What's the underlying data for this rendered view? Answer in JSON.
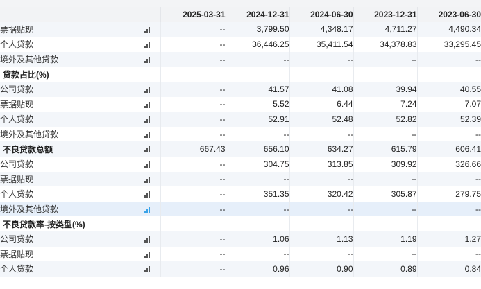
{
  "header": {
    "dates": [
      "2025-03-31",
      "2024-12-31",
      "2024-06-30",
      "2023-12-31",
      "2023-06-30"
    ]
  },
  "rows": [
    {
      "name": "票据贴现",
      "type": "item",
      "values": [
        "--",
        "3,799.50",
        "4,348.17",
        "4,711.27",
        "4,490.34"
      ]
    },
    {
      "name": "个人贷款",
      "type": "item",
      "values": [
        "--",
        "36,446.25",
        "35,411.54",
        "34,378.83",
        "33,295.45"
      ]
    },
    {
      "name": "境外及其他贷款",
      "type": "item",
      "values": [
        "--",
        "--",
        "--",
        "--",
        "--"
      ]
    },
    {
      "name": "贷款占比(%)",
      "type": "section"
    },
    {
      "name": "公司贷款",
      "type": "item",
      "values": [
        "--",
        "41.57",
        "41.08",
        "39.94",
        "40.55"
      ]
    },
    {
      "name": "票据贴现",
      "type": "item",
      "values": [
        "--",
        "5.52",
        "6.44",
        "7.24",
        "7.07"
      ]
    },
    {
      "name": "个人贷款",
      "type": "item",
      "values": [
        "--",
        "52.91",
        "52.48",
        "52.82",
        "52.39"
      ]
    },
    {
      "name": "境外及其他贷款",
      "type": "item",
      "values": [
        "--",
        "--",
        "--",
        "--",
        "--"
      ]
    },
    {
      "name": "不良贷款总额",
      "type": "section-values",
      "values": [
        "667.43",
        "656.10",
        "634.27",
        "615.79",
        "606.41"
      ]
    },
    {
      "name": "公司贷款",
      "type": "item",
      "values": [
        "--",
        "304.75",
        "313.85",
        "309.92",
        "326.66"
      ]
    },
    {
      "name": "票据贴现",
      "type": "item",
      "values": [
        "--",
        "--",
        "--",
        "--",
        "--"
      ]
    },
    {
      "name": "个人贷款",
      "type": "item",
      "values": [
        "--",
        "351.35",
        "320.42",
        "305.87",
        "279.75"
      ]
    },
    {
      "name": "境外及其他贷款",
      "type": "item",
      "highlighted": true,
      "values": [
        "--",
        "--",
        "--",
        "--",
        "--"
      ]
    },
    {
      "name": "不良贷款率-按类型(%)",
      "type": "section"
    },
    {
      "name": "公司贷款",
      "type": "item",
      "values": [
        "--",
        "1.06",
        "1.13",
        "1.19",
        "1.27"
      ]
    },
    {
      "name": "票据贴现",
      "type": "item",
      "values": [
        "--",
        "--",
        "--",
        "--",
        "--"
      ]
    },
    {
      "name": "个人贷款",
      "type": "item",
      "values": [
        "--",
        "0.96",
        "0.90",
        "0.89",
        "0.84"
      ]
    }
  ],
  "colors": {
    "header_bg": "#f2f3f5",
    "stripe_bg": "#f3f6fa",
    "highlight_bg": "#e6effa",
    "chart_icon": "#555555",
    "chart_icon_active": "#3aa3e8"
  },
  "icons": {
    "row_chart": "bar-chart-icon"
  }
}
